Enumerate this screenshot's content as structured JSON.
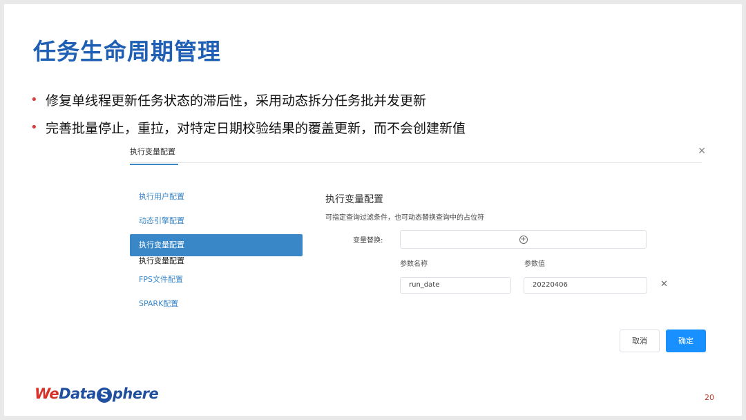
{
  "slide": {
    "title": "任务生命周期管理",
    "bullets": [
      "修复单线程更新任务状态的滞后性，采用动态拆分任务批并发更新",
      "完善批量停止，重拉，对特定日期校验结果的覆盖更新，而不会创建新值"
    ],
    "page_number": "20",
    "logo": {
      "we": "We",
      "data": "Data",
      "s": "S",
      "phere": "phere"
    }
  },
  "dialog": {
    "tab_label": "执行变量配置",
    "close_icon": "close-icon",
    "menu": {
      "items": [
        "执行用户配置",
        "动态引擎配置",
        "执行变量配置"
      ],
      "sub_label": "执行变量配置",
      "items_after": [
        "FPS文件配置",
        "SPARK配置"
      ],
      "active_index": 2
    },
    "section_title": "执行变量配置",
    "section_desc": "可指定查询过滤条件，也可动态替换查询中的占位符",
    "variable_label": "变量替换:",
    "add_icon": "plus-circle-icon",
    "columns": [
      "参数名称",
      "参数值"
    ],
    "row": {
      "name": "run_date",
      "value": "20220406"
    },
    "remove_icon": "close-icon",
    "cancel_label": "取消",
    "confirm_label": "确定",
    "colors": {
      "accent": "#3a87c8",
      "primary_button": "#1890ff",
      "title": "#1f5fb4"
    }
  }
}
